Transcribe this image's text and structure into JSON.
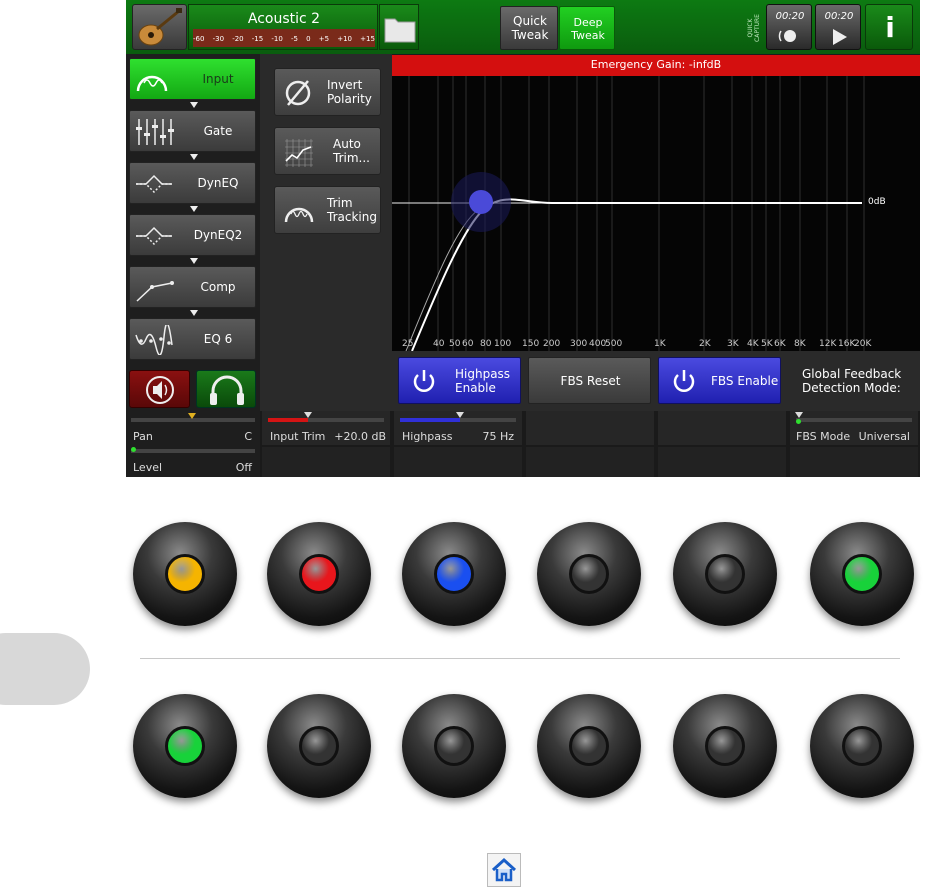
{
  "preset": {
    "name": "Acoustic 2",
    "meter_scale": [
      "-60",
      "-30",
      "-20",
      "-15",
      "-10",
      "-5",
      "0",
      "+5",
      "+10",
      "+15"
    ]
  },
  "tweak": {
    "quick_label": "Quick Tweak",
    "deep_label": "Deep Tweak",
    "active": "Deep Tweak"
  },
  "quick_capture": {
    "label": "QUICK CAPTURE",
    "btn1_time": "00:20",
    "btn2_time": "00:20"
  },
  "info_label": "i",
  "chain": [
    {
      "label": "Input",
      "icon": "input-icon",
      "active": true
    },
    {
      "label": "Gate",
      "icon": "gate-faders-icon",
      "active": false
    },
    {
      "label": "DynEQ",
      "icon": "dyneq-icon",
      "active": false
    },
    {
      "label": "DynEQ2",
      "icon": "dyneq-icon",
      "active": false
    },
    {
      "label": "Comp",
      "icon": "comp-curve-icon",
      "active": false
    },
    {
      "label": "EQ 6",
      "icon": "eq-curve-icon",
      "active": false
    }
  ],
  "controls": {
    "invert_polarity": "Invert Polarity",
    "auto_trim": "Auto Trim...",
    "trim_tracking": "Trim Tracking"
  },
  "graph": {
    "emergency_gain": "Emergency Gain: -infdB",
    "zero_db_label": "0dB",
    "freq_labels": [
      "25",
      "40",
      "50",
      "60",
      "80",
      "100",
      "150",
      "200",
      "300",
      "400",
      "500",
      "1K",
      "2K",
      "3K",
      "4K",
      "5K",
      "6K",
      "8K",
      "12K",
      "16K",
      "20K"
    ],
    "highpass_hz": 75
  },
  "buttons": {
    "highpass_enable": "Highpass Enable",
    "fbs_reset": "FBS Reset",
    "fbs_enable": "FBS Enable",
    "global_feedback": "Global Feedback Detection Mode:"
  },
  "bottom": {
    "pan_label": "Pan",
    "pan_value": "C",
    "level_label": "Level",
    "level_value": "Off",
    "input_trim_label": "Input Trim",
    "input_trim_value": "+20.0 dB",
    "highpass_label": "Highpass",
    "highpass_value": "75 Hz",
    "fbs_mode_label": "FBS Mode",
    "fbs_mode_value": "Universal"
  },
  "knob_row1_colors": [
    "#f5b400",
    "#e8161c",
    "#1a4ff0",
    "#333333",
    "#333333",
    "#18d23a"
  ],
  "knob_row2_colors": [
    "#18d23a",
    "#333333",
    "#333333",
    "#333333",
    "#333333",
    "#333333"
  ],
  "colors": {
    "accent_green": "#1fbf1f",
    "accent_blue": "#2d3fd6",
    "alert_red": "#cc1111"
  },
  "home_icon": "home-icon"
}
